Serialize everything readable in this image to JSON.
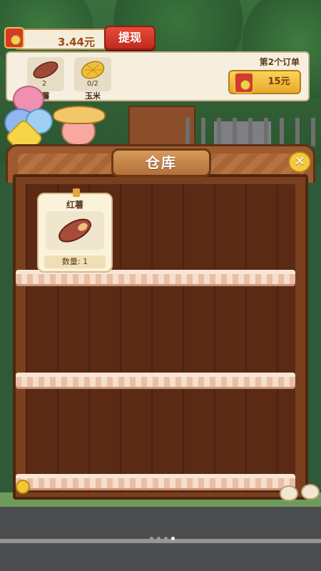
{
  "wallet": {
    "amount": "3.44元",
    "withdraw_label": "提现"
  },
  "order": {
    "title": "第2个订单",
    "reward": "15元",
    "items": [
      {
        "count": "2",
        "name": "薯",
        "icon": "sweet-potato-icon"
      },
      {
        "count": "0/2",
        "name": "玉米",
        "icon": "corn-icon"
      }
    ]
  },
  "warehouse": {
    "title": "仓库",
    "close_icon": "close-icon",
    "items": [
      {
        "name": "红薯",
        "quantity": "数量: 1",
        "icon": "sweet-potato-icon"
      }
    ]
  },
  "pagination": {
    "total": 4,
    "active_index": 3
  },
  "colors": {
    "accent_red": "#d33a2c",
    "gold": "#f4c840",
    "wood": "#7a3f1d",
    "shelf_pink": "#f1d3bf"
  }
}
